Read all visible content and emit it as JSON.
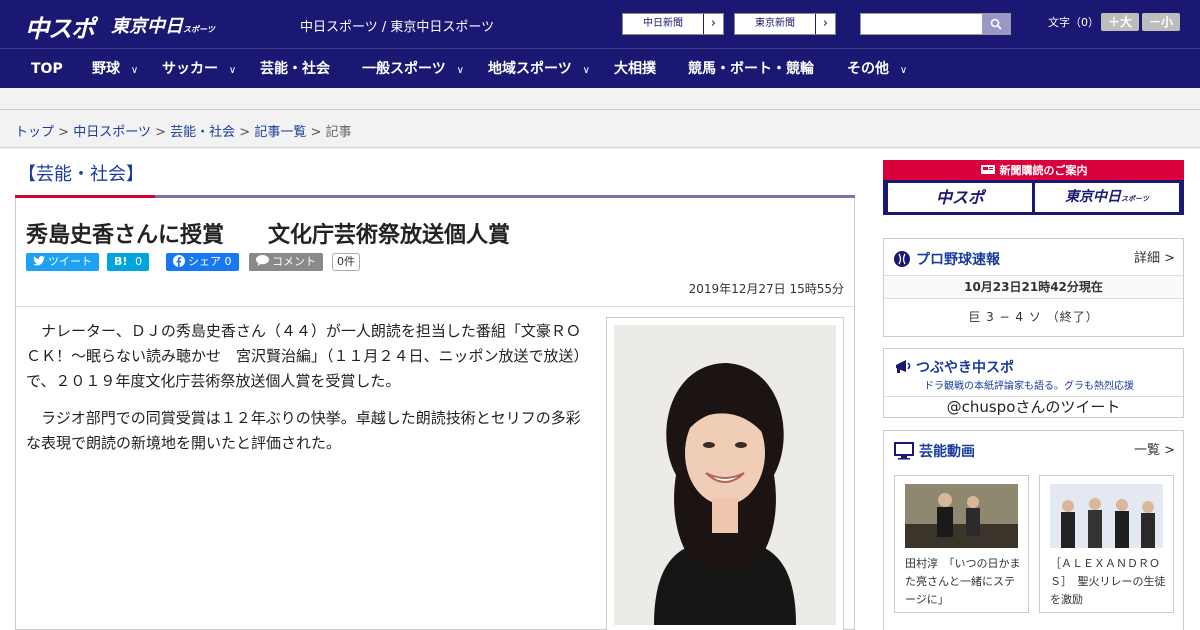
{
  "header": {
    "logo": "中スポ",
    "logo_tokyo": "東京中日",
    "logo_tokyo_sub": "スポーツ",
    "site_links": "中日スポーツ / 東京中日スポーツ",
    "paper_buttons": [
      {
        "label": "中日新聞",
        "arrow": "›"
      },
      {
        "label": "東京新聞",
        "arrow": "›"
      }
    ],
    "search_placeholder": "",
    "font_label": "文字（0）",
    "font_larger": "＋大",
    "font_smaller": "－小"
  },
  "nav": {
    "items": [
      "TOP",
      "野球",
      "サッカー",
      "芸能・社会",
      "一般スポーツ",
      "地域スポーツ",
      "大相撲",
      "競馬・ボート・競輪",
      "その他"
    ],
    "chevron": "∨"
  },
  "breadcrumb": {
    "items": [
      "トップ",
      "中日スポーツ",
      "芸能・社会",
      "記事一覧"
    ],
    "current": "記事",
    "separator": ">"
  },
  "article": {
    "category": "【芸能・社会】",
    "title": "秀島史香さんに授賞　　文化庁芸術祭放送個人賞",
    "share": {
      "tweet": "ツイート",
      "hatena_label": "B!",
      "hatena_count": "0",
      "facebook_label": "シェア",
      "facebook_count": "0",
      "comment": "コメント",
      "comment_count": "0件"
    },
    "date": "2019年12月27日 15時55分",
    "paragraphs": [
      "ナレーター、ＤＪの秀島史香さん（４４）が一人朗読を担当した番組「文豪ＲＯＣＫ！～眠らない読み聴かせ　宮沢賢治編」（１１月２４日、ニッポン放送で放送）で、２０１９年度文化庁芸術祭放送個人賞を受賞した。",
      "ラジオ部門での同賞受賞は１２年ぶりの快挙。卓越した朗読技術とセリフの多彩な表現で朗読の新境地を開いたと評価された。"
    ]
  },
  "sidebar": {
    "subscribe": {
      "title": "新聞購読のご案内",
      "chuspo": "中スポ",
      "tokyo": "東京中日",
      "tokyo_sub": "スポーツ"
    },
    "baseball": {
      "title": "プロ野球速報",
      "more": "詳細 >",
      "updated": "10月23日21時42分現在",
      "score": "巨 3 − 4 ソ （終了）"
    },
    "tsubuyaki": {
      "title": "つぶやき中スポ",
      "subtitle": "ドラ観戦の本紙評論家も語る。グラも熱烈応援",
      "tweets_link": "@chuspoさんのツイート"
    },
    "video": {
      "title": "芸能動画",
      "more": "一覧 >",
      "items": [
        {
          "caption": "田村淳　「いつの日かまた亮さんと一緒にステージに」"
        },
        {
          "caption": "［ＡＬＥＸＡＮＤＲＯＳ］　聖火リレーの生徒を激励"
        }
      ]
    }
  },
  "colors": {
    "brand_navy": "#1a1872",
    "accent_red": "#d7003a",
    "link_blue": "#1a3c9e",
    "twitter": "#1da1f2",
    "hatena": "#00a4de",
    "facebook": "#1877f2",
    "comment": "#8a8a8a"
  }
}
